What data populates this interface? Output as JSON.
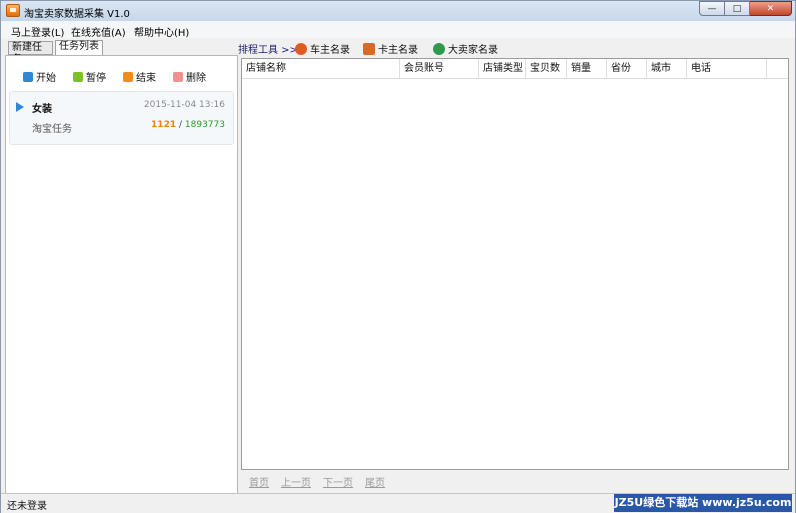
{
  "window": {
    "title": "淘宝卖家数据采集 V1.0",
    "controls": {
      "minimize": "—",
      "maximize": "□",
      "close": "✕"
    }
  },
  "menu": [
    {
      "label": "马上登录(L)"
    },
    {
      "label": "在线充值(A)"
    },
    {
      "label": "帮助中心(H)"
    }
  ],
  "left": {
    "tabs": [
      "新建任务",
      "任务列表"
    ],
    "toolbar": [
      {
        "label": "开始",
        "icon": "play-icon",
        "color": "#2f87d8"
      },
      {
        "label": "暂停",
        "icon": "pause-icon",
        "color": "#7cc12a"
      },
      {
        "label": "结束",
        "icon": "stop-icon",
        "color": "#f08c1c"
      },
      {
        "label": "删除",
        "icon": "delete-icon",
        "color": "#f19090"
      }
    ],
    "task": {
      "name": "女装",
      "time": "2015-11-04 13:16",
      "type": "淘宝任务",
      "done": "1121",
      "separator": "/",
      "total": "1893773"
    }
  },
  "right": {
    "toolbar_label": "排程工具 >>",
    "toolbar": [
      {
        "label": "车主名录",
        "icon": "car-icon",
        "color": "#e05a22"
      },
      {
        "label": "卡主名录",
        "icon": "house-icon",
        "color": "#d96b1f"
      },
      {
        "label": "大卖家名录",
        "icon": "globe-icon",
        "color": "#2f9a4e"
      }
    ],
    "columns": [
      "店铺名称",
      "会员账号",
      "店铺类型",
      "宝贝数",
      "销量",
      "省份",
      "城市",
      "电话"
    ],
    "pager": [
      "首页",
      "上一页",
      "下一页",
      "尾页"
    ]
  },
  "status": {
    "text": "还未登录",
    "watermark": "JZ5U绿色下载站 www.jz5u.com"
  }
}
